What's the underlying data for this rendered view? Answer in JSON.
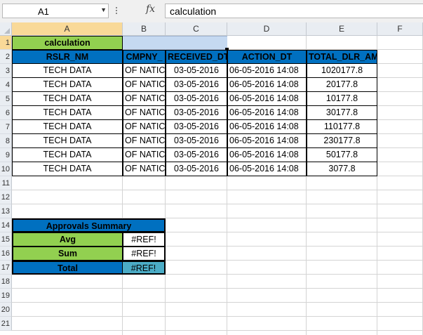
{
  "formula_bar": {
    "name_box": "A1",
    "fx_label": "fx",
    "formula": "calculation"
  },
  "columns": [
    "A",
    "B",
    "C",
    "D",
    "E",
    "F"
  ],
  "rows": [
    "1",
    "2",
    "3",
    "4",
    "5",
    "6",
    "7",
    "8",
    "9",
    "10",
    "11",
    "12",
    "13",
    "14",
    "15",
    "16",
    "17",
    "18",
    "19",
    "20",
    "21"
  ],
  "colors": {
    "green": "#92d050",
    "blue_header": "#0070c0",
    "light_blue": "#c5d9f1",
    "teal": "#4bacc6",
    "grid": "#d4d4d4"
  },
  "sheet": {
    "a1": "calculation",
    "headers": [
      "RSLR_NM",
      "CMPNY_",
      "RECEIVED_DT",
      "ACTION_DT",
      "TOTAL_DLR_AM"
    ],
    "data": [
      [
        "TECH DATA",
        "OF NATIC",
        "03-05-2016",
        "06-05-2016 14:08",
        "1020177.8"
      ],
      [
        "TECH DATA",
        "OF NATIC",
        "03-05-2016",
        "06-05-2016 14:08",
        "20177.8"
      ],
      [
        "TECH DATA",
        "OF NATIC",
        "03-05-2016",
        "06-05-2016 14:08",
        "10177.8"
      ],
      [
        "TECH DATA",
        "OF NATIC",
        "03-05-2016",
        "06-05-2016 14:08",
        "30177.8"
      ],
      [
        "TECH DATA",
        "OF NATIC",
        "03-05-2016",
        "06-05-2016 14:08",
        "110177.8"
      ],
      [
        "TECH DATA",
        "OF NATIC",
        "03-05-2016",
        "06-05-2016 14:08",
        "230177.8"
      ],
      [
        "TECH DATA",
        "OF NATIC",
        "03-05-2016",
        "06-05-2016 14:08",
        "50177.8"
      ],
      [
        "TECH DATA",
        "OF NATIC",
        "03-05-2016",
        "06-05-2016 14:08",
        "3077.8"
      ]
    ],
    "summary": {
      "title": "Approvals Summary",
      "avg_label": "Avg",
      "avg_value": "#REF!",
      "sum_label": "Sum",
      "sum_value": "#REF!",
      "total_label": "Total",
      "total_value": "#REF!"
    }
  }
}
